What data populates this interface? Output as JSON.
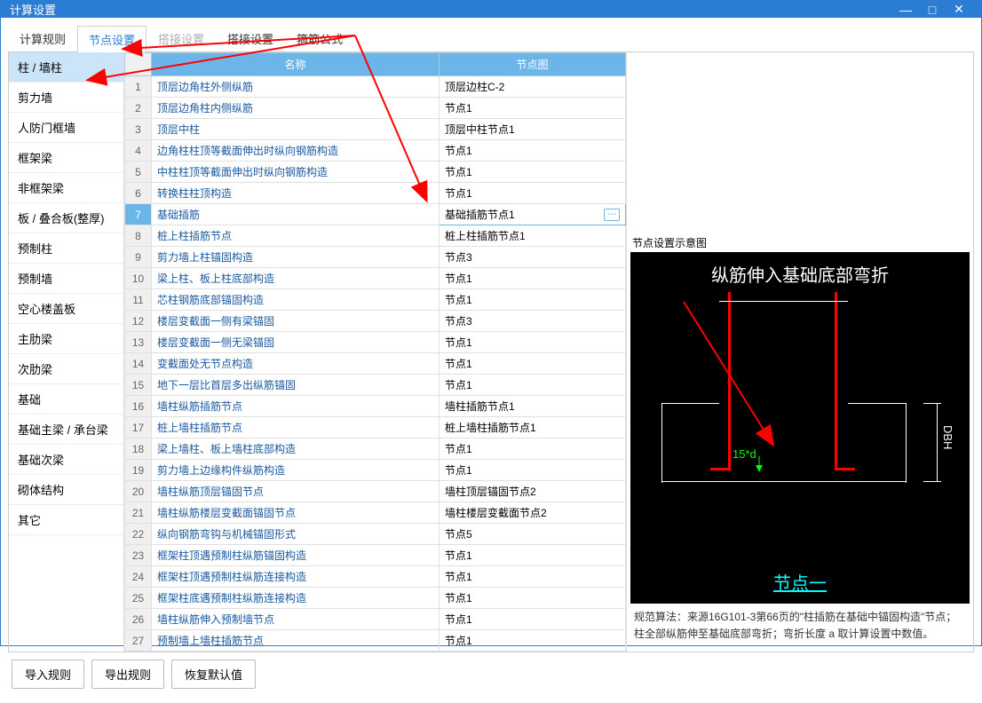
{
  "window_title": "计算设置",
  "tabs": [
    "计算规则",
    "节点设置",
    "搭接设置",
    "搭接设置",
    "箍筋公式"
  ],
  "active_tab": 1,
  "sidebar": {
    "items": [
      "柱 / 墙柱",
      "剪力墙",
      "人防门框墙",
      "框架梁",
      "非框架梁",
      "板 / 叠合板(整厚)",
      "预制柱",
      "预制墙",
      "空心楼盖板",
      "主肋梁",
      "次肋梁",
      "基础",
      "基础主梁 / 承台梁",
      "基础次梁",
      "砌体结构",
      "其它"
    ],
    "active": 0
  },
  "table": {
    "headers": [
      "",
      "名称",
      "节点图"
    ],
    "selected": 6,
    "rows": [
      {
        "n": "1",
        "name": "顶层边角柱外侧纵筋",
        "node": "顶层边柱C-2"
      },
      {
        "n": "2",
        "name": "顶层边角柱内侧纵筋",
        "node": "节点1"
      },
      {
        "n": "3",
        "name": "顶层中柱",
        "node": "顶层中柱节点1"
      },
      {
        "n": "4",
        "name": "边角柱柱顶等截面伸出时纵向钢筋构造",
        "node": "节点1"
      },
      {
        "n": "5",
        "name": "中柱柱顶等截面伸出时纵向钢筋构造",
        "node": "节点1"
      },
      {
        "n": "6",
        "name": "转换柱柱顶构造",
        "node": "节点1"
      },
      {
        "n": "7",
        "name": "基础插筋",
        "node": "基础插筋节点1"
      },
      {
        "n": "8",
        "name": "桩上柱插筋节点",
        "node": "桩上柱插筋节点1"
      },
      {
        "n": "9",
        "name": "剪力墙上柱锚固构造",
        "node": "节点3"
      },
      {
        "n": "10",
        "name": "梁上柱、板上柱底部构造",
        "node": "节点1"
      },
      {
        "n": "11",
        "name": "芯柱钢筋底部锚固构造",
        "node": "节点1"
      },
      {
        "n": "12",
        "name": "楼层变截面一侧有梁锚固",
        "node": "节点3"
      },
      {
        "n": "13",
        "name": "楼层变截面一侧无梁锚固",
        "node": "节点1"
      },
      {
        "n": "14",
        "name": "变截面处无节点构造",
        "node": "节点1"
      },
      {
        "n": "15",
        "name": "地下一层比首层多出纵筋锚固",
        "node": "节点1"
      },
      {
        "n": "16",
        "name": "墙柱纵筋插筋节点",
        "node": "墙柱插筋节点1"
      },
      {
        "n": "17",
        "name": "桩上墙柱插筋节点",
        "node": "桩上墙柱插筋节点1"
      },
      {
        "n": "18",
        "name": "梁上墙柱、板上墙柱底部构造",
        "node": "节点1"
      },
      {
        "n": "19",
        "name": "剪力墙上边缘构件纵筋构造",
        "node": "节点1"
      },
      {
        "n": "20",
        "name": "墙柱纵筋顶层锚固节点",
        "node": "墙柱顶层锚固节点2"
      },
      {
        "n": "21",
        "name": "墙柱纵筋楼层变截面锚固节点",
        "node": "墙柱楼层变截面节点2"
      },
      {
        "n": "22",
        "name": "纵向钢筋弯钩与机械锚固形式",
        "node": "节点5"
      },
      {
        "n": "23",
        "name": "框架柱顶遇预制柱纵筋锚固构造",
        "node": "节点1"
      },
      {
        "n": "24",
        "name": "框架柱顶遇预制柱纵筋连接构造",
        "node": "节点1"
      },
      {
        "n": "25",
        "name": "框架柱底遇预制柱纵筋连接构造",
        "node": "节点1"
      },
      {
        "n": "26",
        "name": "墙柱纵筋伸入预制墙节点",
        "node": "节点1"
      },
      {
        "n": "27",
        "name": "预制墙上墙柱插筋节点",
        "node": "节点1"
      }
    ]
  },
  "preview": {
    "title": "节点设置示意图",
    "diagram_title": "纵筋伸入基础底部弯折",
    "dim_label": "15*d",
    "dbh_label": "DBH",
    "node_label": "节点一",
    "note": "规范算法：来源16G101-3第66页的\"柱插筋在基础中锚固构造\"节点；柱全部纵筋伸至基础底部弯折；弯折长度 a 取计算设置中数值。"
  },
  "footer": {
    "import": "导入规则",
    "export": "导出规则",
    "restore": "恢复默认值"
  }
}
